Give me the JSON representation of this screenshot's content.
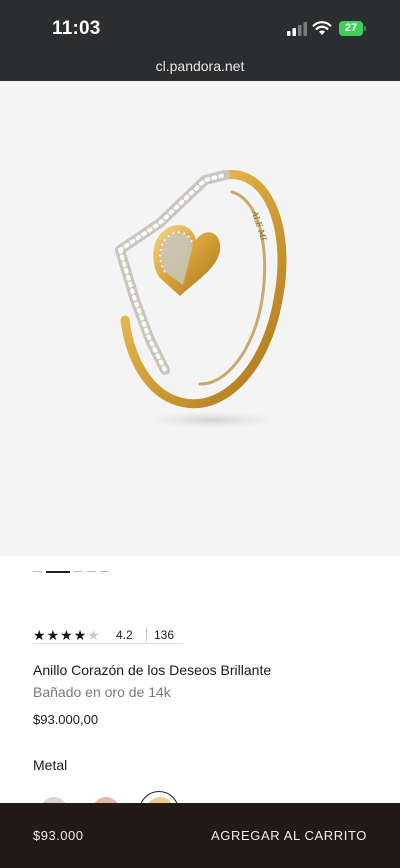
{
  "status_bar": {
    "time": "11:03",
    "battery": "27"
  },
  "browser": {
    "url": "cl.pandora.net"
  },
  "product": {
    "rating": {
      "value": "4.2",
      "count": "136",
      "stars_filled": 4,
      "stars_total": 5
    },
    "title": "Anillo Corazón de los Deseos Brillante",
    "subtitle": "Bañado en oro de 14k",
    "price": "$93.000,00",
    "image": {
      "engraving": "ALE MI",
      "slide_count": 6,
      "active_slide": 2
    }
  },
  "options": {
    "metal_label": "Metal",
    "swatches": [
      "silver",
      "rose-gold",
      "gold"
    ],
    "selected": "gold"
  },
  "cart_bar": {
    "price": "$93.000",
    "button_label": "AGREGAR AL CARRITO"
  },
  "colors": {
    "status_bg": "#2b2d2e",
    "cart_bar_bg": "#231916",
    "image_bg": "#f4f4f4",
    "battery_green": "#3dd15a",
    "gold": "#d9a53b"
  }
}
